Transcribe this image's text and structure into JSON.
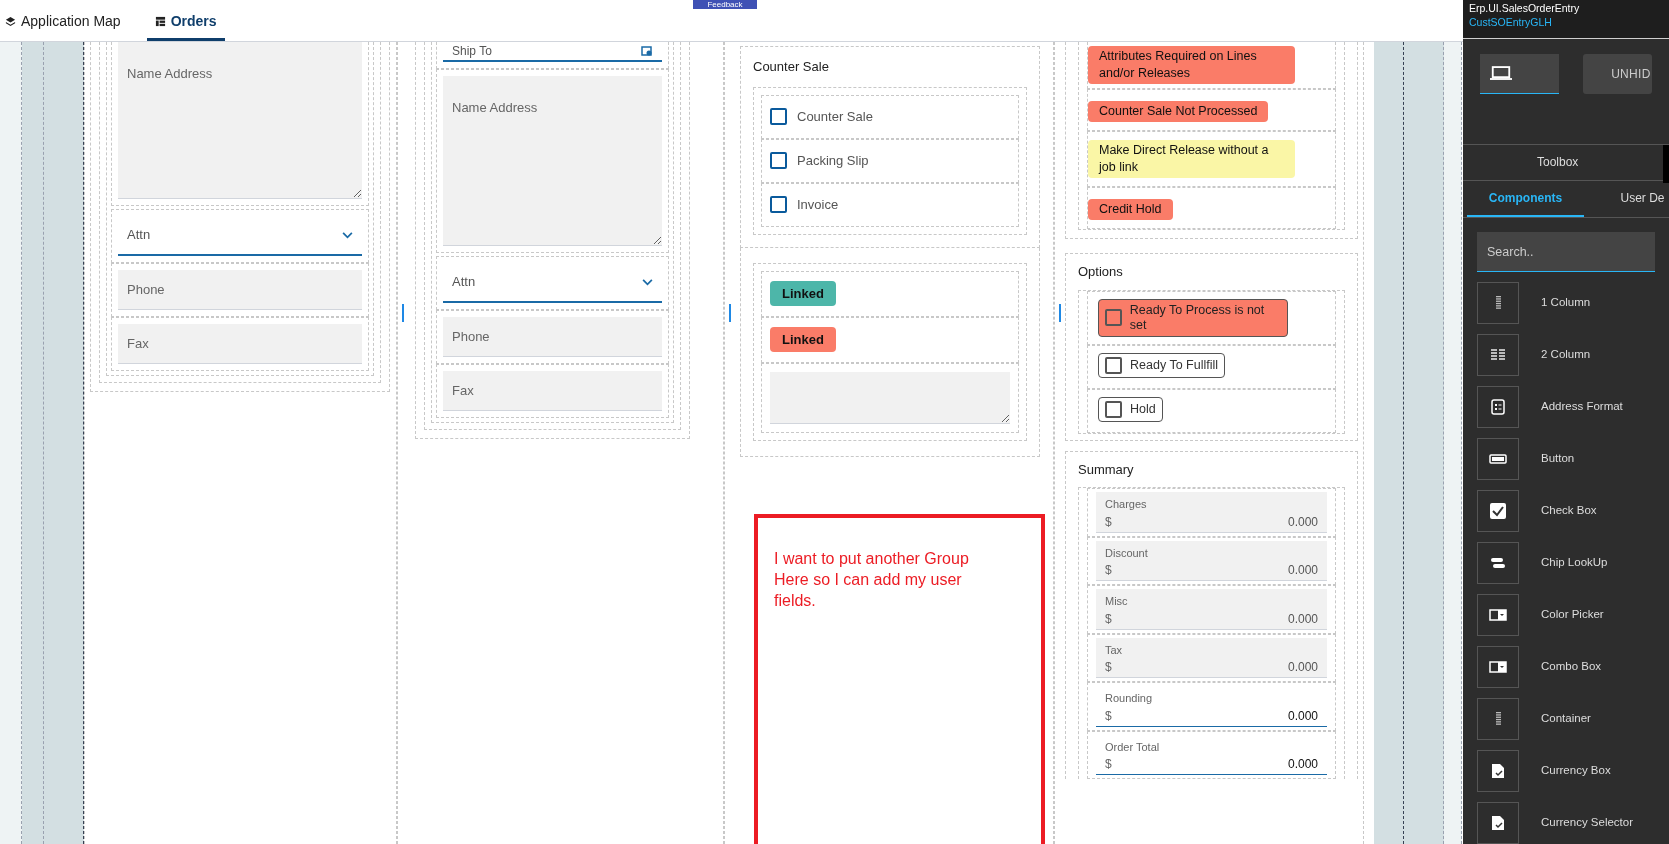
{
  "tabs": [
    {
      "label": "Application Map",
      "kind": "map",
      "selected": false
    },
    {
      "label": "Orders",
      "kind": "orders",
      "selected": true
    }
  ],
  "feedback": "Feedback",
  "bill_to": {
    "name_address": {
      "placeholder": "Name Address"
    },
    "attn": "Attn",
    "phone": {
      "placeholder": "Phone"
    },
    "fax": {
      "placeholder": "Fax"
    }
  },
  "ship_to": {
    "label": "Ship To",
    "name_address": {
      "placeholder": "Name Address"
    },
    "attn": "Attn",
    "phone": {
      "placeholder": "Phone"
    },
    "fax": {
      "placeholder": "Fax"
    }
  },
  "counter_sale": {
    "title": "Counter Sale",
    "checkboxes": [
      {
        "label": "Counter Sale",
        "checked": false
      },
      {
        "label": "Packing Slip",
        "checked": false
      },
      {
        "label": "Invoice",
        "checked": false
      }
    ]
  },
  "links": [
    {
      "label": "Linked",
      "color": "#4db6a9"
    },
    {
      "label": "Linked",
      "color": "#fa7c68"
    }
  ],
  "annotation": "I want to put another Group Here so I can add my user fields.",
  "alerts": [
    {
      "text": "Attributes Required on Lines and/or Releases",
      "color": "#fa7c68"
    },
    {
      "text": "Counter Sale Not Processed",
      "color": "#fa7c68"
    },
    {
      "text": "Make Direct Release without a job link",
      "color": "#faf6a6"
    },
    {
      "text": "Credit Hold",
      "color": "#fa7c68"
    }
  ],
  "options": {
    "title": "Options",
    "items": [
      {
        "label": "Ready To Process is not set",
        "checked": false,
        "kind": "alert"
      },
      {
        "label": "Ready To Fullfill",
        "checked": false,
        "kind": "plain"
      },
      {
        "label": "Hold",
        "checked": false,
        "kind": "plain"
      }
    ]
  },
  "summary": {
    "title": "Summary",
    "fields": [
      {
        "label": "Charges",
        "currency": "$",
        "value": "0.000",
        "editable": false
      },
      {
        "label": "Discount",
        "currency": "$",
        "value": "0.000",
        "editable": false
      },
      {
        "label": "Misc",
        "currency": "$",
        "value": "0.000",
        "editable": false
      },
      {
        "label": "Tax",
        "currency": "$",
        "value": "0.000",
        "editable": false
      },
      {
        "label": "Rounding",
        "currency": "$",
        "value": "0.000",
        "editable": true
      },
      {
        "label": "Order Total",
        "currency": "$",
        "value": "0.000",
        "editable": true
      }
    ]
  },
  "designer": {
    "form": "Erp.UI.SalesOrderEntry",
    "layer": "CustSOEntryGLH",
    "device_button": {
      "selected": true
    },
    "unhide": "UNHID",
    "panel_tab": "Toolbox",
    "tabs": [
      {
        "label": "Components",
        "selected": true
      },
      {
        "label": "User De",
        "selected": false
      }
    ],
    "search": {
      "placeholder": "Search.."
    },
    "components": [
      {
        "label": "1 Column",
        "kind": "col1"
      },
      {
        "label": "2 Column",
        "kind": "col2"
      },
      {
        "label": "Address Format",
        "kind": "address"
      },
      {
        "label": "Button",
        "kind": "button"
      },
      {
        "label": "Check Box",
        "kind": "check"
      },
      {
        "label": "Chip LookUp",
        "kind": "chip"
      },
      {
        "label": "Color Picker",
        "kind": "combo"
      },
      {
        "label": "Combo Box",
        "kind": "combo"
      },
      {
        "label": "Container",
        "kind": "col1"
      },
      {
        "label": "Currency Box",
        "kind": "doc"
      },
      {
        "label": "Currency Selector",
        "kind": "doc"
      }
    ]
  }
}
